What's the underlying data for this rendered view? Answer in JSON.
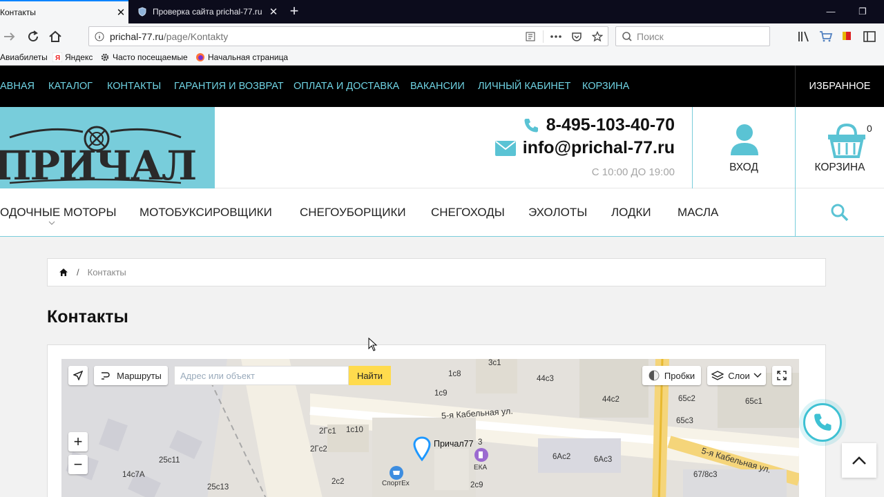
{
  "browser": {
    "tabs": [
      {
        "title": "Контакты",
        "active": true
      },
      {
        "title": "Проверка сайта prichal-77.ru",
        "active": false
      }
    ],
    "url_host": "prichal-77.ru",
    "url_path": "/page/Kontakty",
    "search_placeholder": "Поиск",
    "bookmarks": [
      "Авиабилеты",
      "Яндекс",
      "Часто посещаемые",
      "Начальная страница"
    ]
  },
  "site": {
    "top_menu": [
      "АВНАЯ",
      "КАТАЛОГ",
      "КОНТАКТЫ",
      "ГАРАНТИЯ И ВОЗВРАТ",
      "ОПЛАТА И ДОСТАВКА",
      "ВАКАНСИИ",
      "ЛИЧНЫЙ КАБИНЕТ",
      "КОРЗИНА"
    ],
    "favorites": "ИЗБРАННОЕ",
    "logo_text": "ПРИЧАЛ",
    "phone": "8-495-103-40-70",
    "email": "info@prichal-77.ru",
    "hours": "С 10:00 ДО 19:00",
    "login_label": "ВХОД",
    "cart_label": "КОРЗИНА",
    "cart_count": "0",
    "categories": [
      "ОДОЧНЫЕ МОТОРЫ",
      "МОТОБУКСИРОВЩИКИ",
      "СНЕГОУБОРЩИКИ",
      "СНЕГОХОДЫ",
      "ЭХОЛОТЫ",
      "ЛОДКИ",
      "МАСЛА"
    ],
    "breadcrumb_current": "Контакты",
    "page_title": "Контакты"
  },
  "map": {
    "routes_label": "Маршруты",
    "search_placeholder": "Адрес или объект",
    "find_label": "Найти",
    "traffic_label": "Пробки",
    "layers_label": "Слои",
    "zoom_in": "+",
    "zoom_out": "−",
    "marker_label": "Причал77",
    "street": "5-я Кабельная ул.",
    "labels": [
      "3с1",
      "1с8",
      "44с3",
      "1с9",
      "44с2",
      "65с2",
      "65с1",
      "65с3",
      "2Гс1",
      "1с10",
      "2Гс2",
      "25с11",
      "14с7А",
      "25с13",
      "2с2",
      "2с9",
      "6Ас2",
      "6Ас3",
      "67/8с3",
      "3",
      "ЕКА",
      "СпортЕх"
    ]
  },
  "colors": {
    "accent": "#3ec1d3",
    "logo_bg": "#78cddb",
    "menu_text": "#6fd3e3"
  }
}
